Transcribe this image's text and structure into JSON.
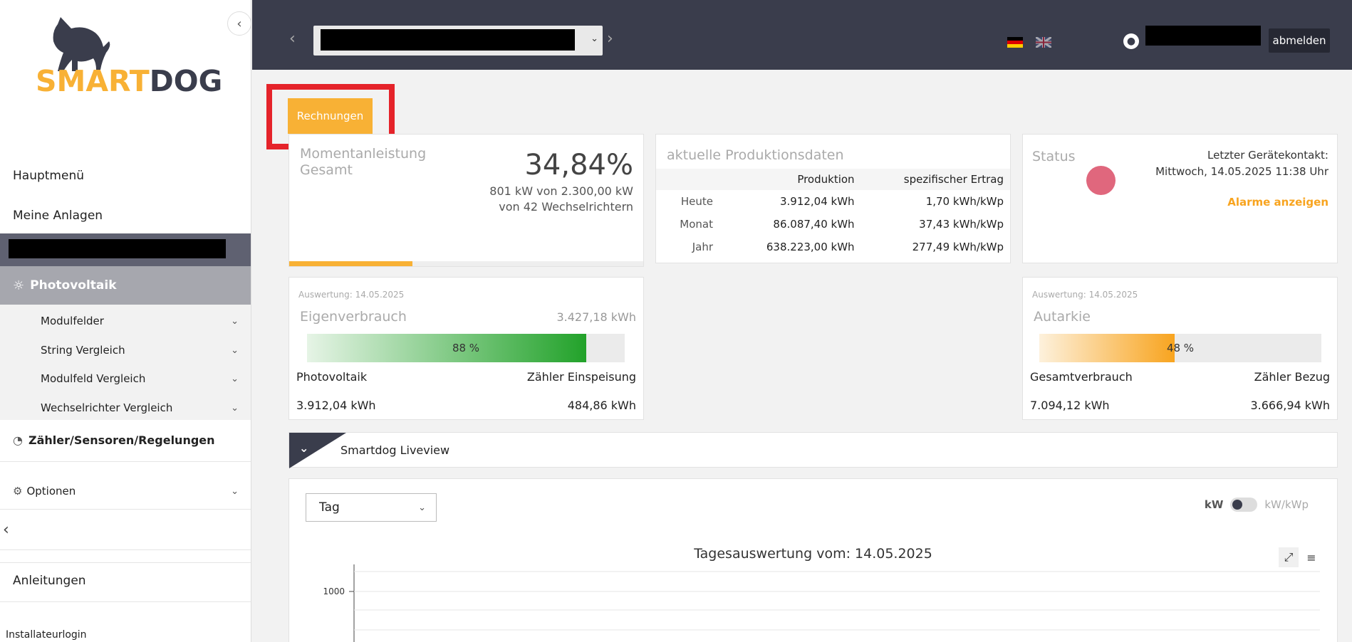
{
  "sidebar": {
    "logo_smart": "SMART",
    "logo_dog": "DOG",
    "main_menu": "Hauptmenü",
    "my_plants": "Meine Anlagen",
    "photovoltaik": "Photovoltaik",
    "sub_items": [
      "Modulfelder",
      "String Vergleich",
      "Modulfeld Vergleich",
      "Wechselrichter Vergleich"
    ],
    "zaehler": "Zähler/Sensoren/Regelungen",
    "optionen": "Optionen",
    "anleitungen": "Anleitungen",
    "installateur": "Installateurlogin"
  },
  "topbar": {
    "logout": "abmelden"
  },
  "actions": {
    "rechnungen": "Rechnungen"
  },
  "moment": {
    "label_line1": "Momentanleistung",
    "label_line2": "Gesamt",
    "percent": "34,84%",
    "power": "801 kW von 2.300,00 kW",
    "inverters": "von 42 Wechselrichtern",
    "progress": 34.84
  },
  "production": {
    "title": "aktuelle Produktionsdaten",
    "headers": [
      "",
      "Produktion",
      "spezifischer Ertrag"
    ],
    "rows": [
      {
        "label": "Heute",
        "production": "3.912,04 kWh",
        "specific": "1,70 kWh/kWp"
      },
      {
        "label": "Monat",
        "production": "86.087,40 kWh",
        "specific": "37,43 kWh/kWp"
      },
      {
        "label": "Jahr",
        "production": "638.223,00 kWh",
        "specific": "277,49 kWh/kWp"
      }
    ]
  },
  "status": {
    "title": "Status",
    "last_contact_label": "Letzter Gerätekontakt:",
    "last_contact_value": "Mittwoch, 14.05.2025 11:38 Uhr",
    "alarms_link": "Alarme anzeigen",
    "status_color": "#e0677d"
  },
  "eigenverbrauch": {
    "date": "Auswertung: 14.05.2025",
    "title": "Eigenverbrauch",
    "total": "3.427,18 kWh",
    "percent_label": "88 %",
    "percent": 88,
    "left_label": "Photovoltaik",
    "right_label": "Zähler Einspeisung",
    "left_value": "3.912,04 kWh",
    "right_value": "484,86 kWh"
  },
  "autarkie": {
    "date": "Auswertung: 14.05.2025",
    "title": "Autarkie",
    "percent_label": "48 %",
    "percent": 48,
    "left_label": "Gesamtverbrauch",
    "right_label": "Zähler Bezug",
    "left_value": "7.094,12 kWh",
    "right_value": "3.666,94 kWh"
  },
  "liveview": {
    "title": "Smartdog Liveview"
  },
  "chart": {
    "period_select": "Tag",
    "unit_left": "kW",
    "unit_right": "kW/kWp",
    "title": "Tagesauswertung vom: 14.05.2025",
    "y_tick": "1000"
  },
  "colors": {
    "accent": "#f8b135",
    "dark": "#3a3d4c",
    "highlight": "#e5232a",
    "green": "#22a22a"
  }
}
